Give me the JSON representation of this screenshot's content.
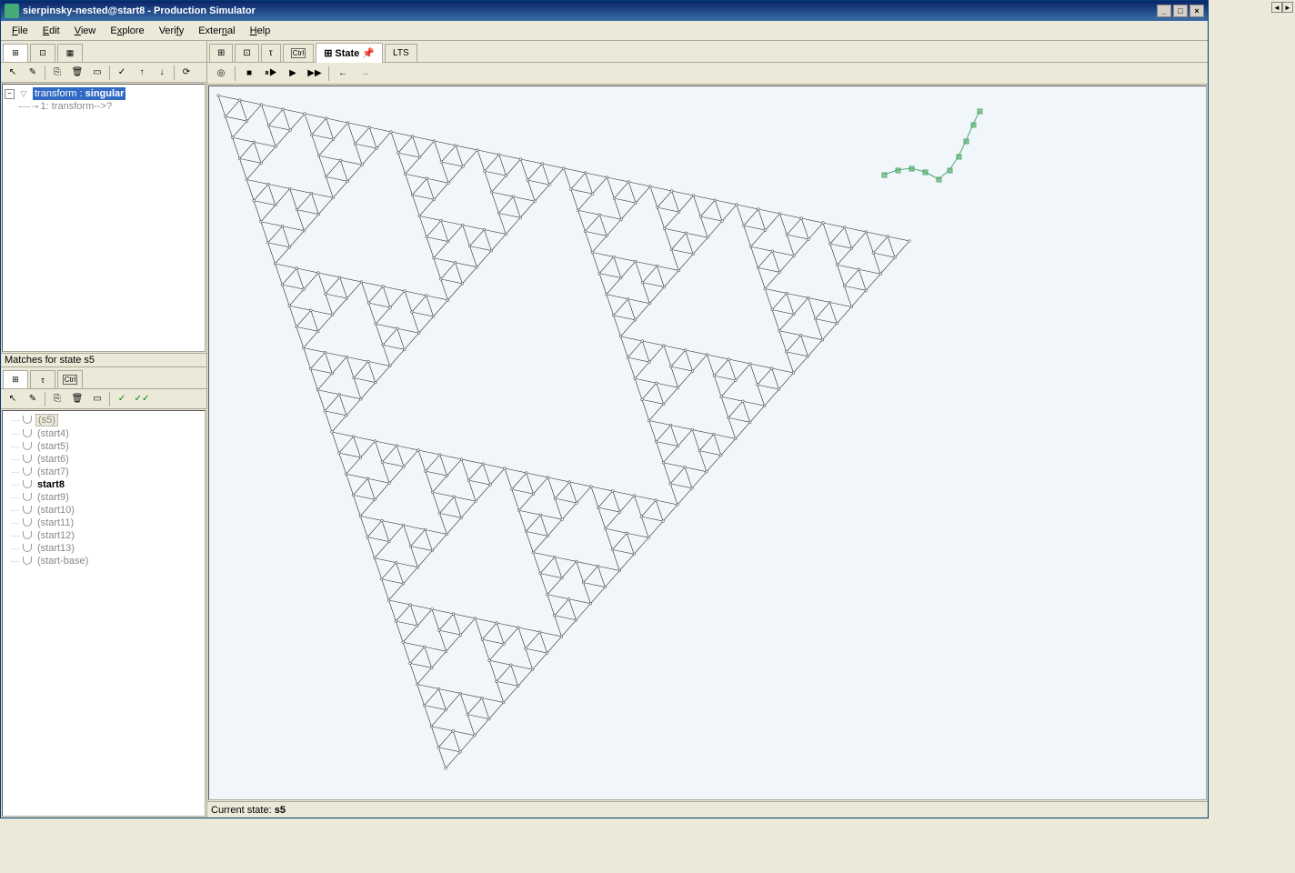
{
  "titlebar": {
    "text": "sierpinsky-nested@start8 - Production Simulator"
  },
  "menubar": {
    "items": [
      "File",
      "Edit",
      "View",
      "Explore",
      "Verify",
      "External",
      "Help"
    ]
  },
  "leftTop": {
    "tree": {
      "root_label": "transform :",
      "root_suffix": "singular",
      "child_label": "1: transform-->?"
    }
  },
  "leftMid": {
    "header": "Matches for state s5"
  },
  "leftBottom": {
    "items": [
      {
        "label": "(s5)",
        "selected": true,
        "bold": false
      },
      {
        "label": "(start4)",
        "selected": false,
        "bold": false
      },
      {
        "label": "(start5)",
        "selected": false,
        "bold": false
      },
      {
        "label": "(start6)",
        "selected": false,
        "bold": false
      },
      {
        "label": "(start7)",
        "selected": false,
        "bold": false
      },
      {
        "label": "start8",
        "selected": false,
        "bold": true
      },
      {
        "label": "(start9)",
        "selected": false,
        "bold": false
      },
      {
        "label": "(start10)",
        "selected": false,
        "bold": false
      },
      {
        "label": "(start11)",
        "selected": false,
        "bold": false
      },
      {
        "label": "(start12)",
        "selected": false,
        "bold": false
      },
      {
        "label": "(start13)",
        "selected": false,
        "bold": false
      },
      {
        "label": "(start-base)",
        "selected": false,
        "bold": false
      }
    ]
  },
  "rightTabs": {
    "items": [
      {
        "label": "",
        "icon": "rule"
      },
      {
        "label": "",
        "icon": "rule2"
      },
      {
        "label": "τ",
        "icon": ""
      },
      {
        "label": "Ctrl",
        "icon": ""
      },
      {
        "label": "State",
        "icon": "state",
        "active": true,
        "pin": true
      },
      {
        "label": "LTS",
        "icon": ""
      }
    ]
  },
  "statusbar": {
    "label": "Current state:",
    "value": "s5"
  }
}
